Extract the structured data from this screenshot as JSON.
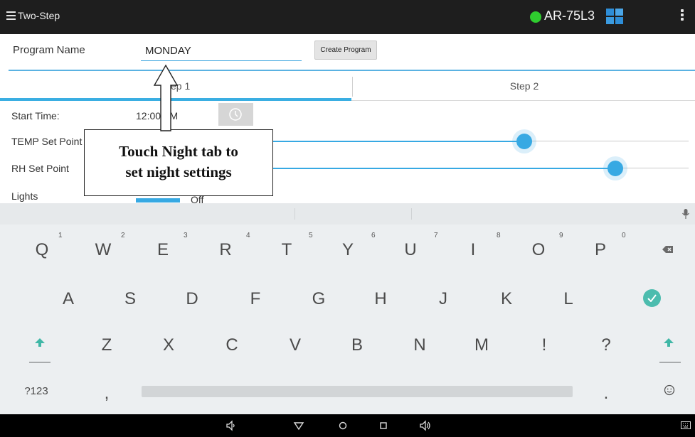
{
  "topbar": {
    "title": "Two-Step",
    "device_name": "AR-75L3",
    "status_color": "#2fcd2f",
    "icons": [
      "menu-icon",
      "status-dot-icon",
      "grid-icon",
      "overflow-menu-icon"
    ]
  },
  "program": {
    "name_label": "Program Name",
    "name_value": "MONDAY",
    "create_button": "Create Program"
  },
  "tabs": [
    {
      "label": "Step 1",
      "selected": true
    },
    {
      "label": "Step 2",
      "selected": false
    }
  ],
  "settings": {
    "start_time_label": "Start Time:",
    "start_time_value": "12:00 AM",
    "temp_label": "TEMP Set Point",
    "rh_label": "RH Set Point",
    "lights_label": "Lights",
    "lights_value": "Off",
    "temp_slider_fraction": 0.62,
    "rh_slider_fraction": 0.83
  },
  "callout": {
    "line1": "Touch Night tab to",
    "line2": "set night settings"
  },
  "keyboard": {
    "row1": [
      "Q",
      "W",
      "E",
      "R",
      "T",
      "Y",
      "U",
      "I",
      "O",
      "P"
    ],
    "row1_hints": [
      "1",
      "2",
      "3",
      "4",
      "5",
      "6",
      "7",
      "8",
      "9",
      "0"
    ],
    "row2": [
      "A",
      "S",
      "D",
      "F",
      "G",
      "H",
      "J",
      "K",
      "L"
    ],
    "row3": [
      "Z",
      "X",
      "C",
      "V",
      "B",
      "N",
      "M",
      "!",
      "?"
    ],
    "symbols_key": "?123",
    "comma_key": ",",
    "period_key": ".",
    "accent_color": "#4cbcae"
  },
  "navbar": {
    "icons": [
      "volume-down-icon",
      "back-icon",
      "home-icon",
      "recents-icon",
      "volume-up-icon",
      "keyboard-icon"
    ]
  }
}
